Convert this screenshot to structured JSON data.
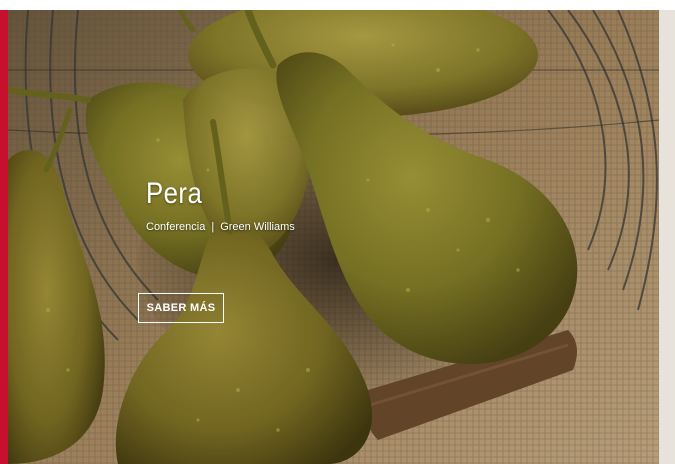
{
  "hero": {
    "title": "Pera",
    "subtitle_part1": "Conferencia",
    "subtitle_separator": "|",
    "subtitle_part2": "Green Williams",
    "cta_label": "SABER MÁS"
  },
  "colors": {
    "accent_red": "#c8102e",
    "pear_green": "#8a8a2a",
    "burlap": "#b79a73"
  }
}
